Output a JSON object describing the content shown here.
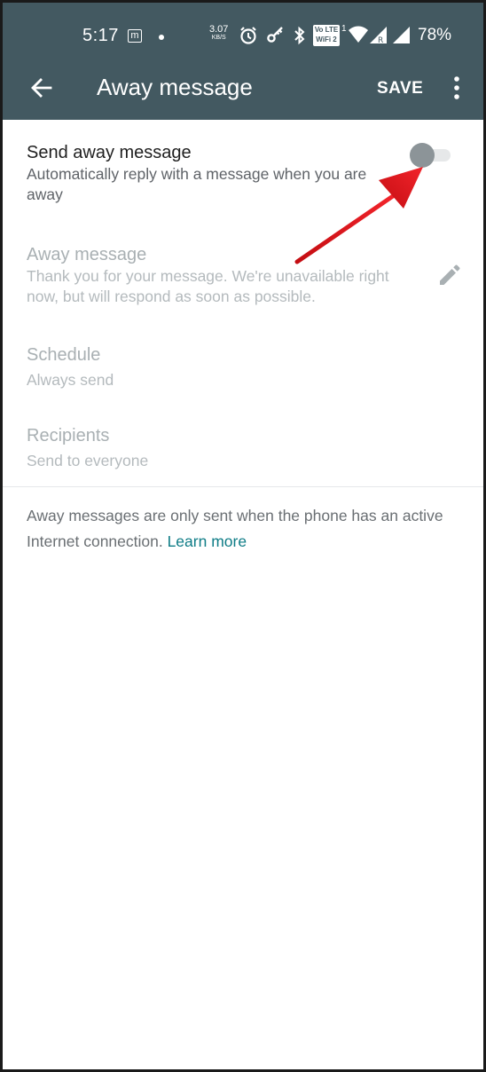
{
  "status_bar": {
    "time": "5:17",
    "notification_letter": "m",
    "net_speed_value": "3.07",
    "net_speed_unit": "KB/S",
    "volte_label": "Vo LTE",
    "wifi_call_label": "WiFi 2",
    "sim_label": "1",
    "battery": "78%"
  },
  "toolbar": {
    "title": "Away message",
    "save_label": "SAVE"
  },
  "settings": {
    "send_away": {
      "title": "Send away message",
      "subtitle": "Automatically reply with a message when you are away",
      "enabled": false
    },
    "away_message": {
      "title": "Away message",
      "text": "Thank you for your message. We're unavailable right now, but will respond as soon as possible."
    },
    "schedule": {
      "title": "Schedule",
      "value": "Always send"
    },
    "recipients": {
      "title": "Recipients",
      "value": "Send to everyone"
    }
  },
  "footer": {
    "note": "Away messages are only sent when the phone has an active Internet connection. ",
    "link": "Learn more"
  },
  "colors": {
    "appbar": "#435961",
    "link": "#0e7c86",
    "annotation_arrow": "#e8141b"
  }
}
